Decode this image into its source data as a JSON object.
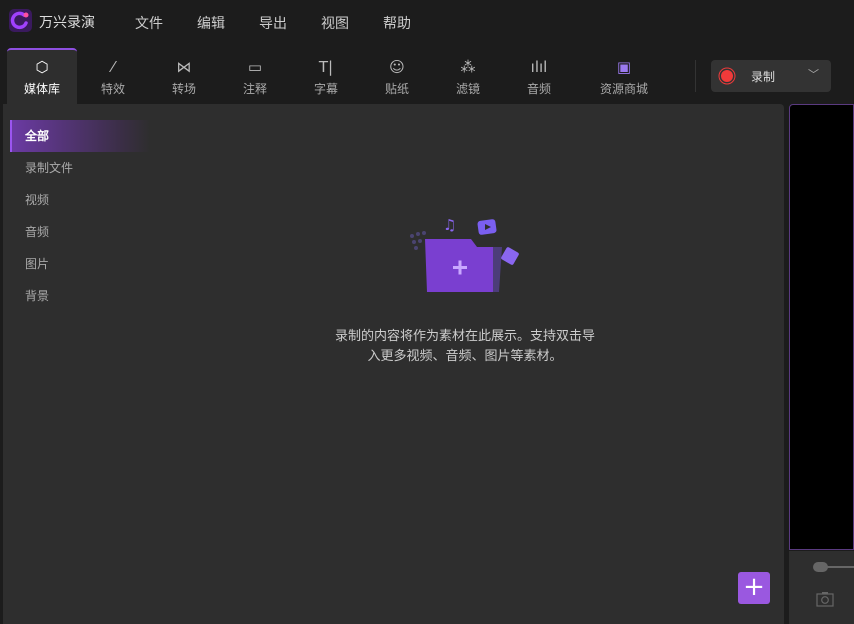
{
  "app": {
    "title": "万兴录演"
  },
  "menu": [
    "文件",
    "编辑",
    "导出",
    "视图",
    "帮助"
  ],
  "tabs": [
    {
      "label": "媒体库",
      "icon": "cube-icon"
    },
    {
      "label": "特效",
      "icon": "magic-wand-icon"
    },
    {
      "label": "转场",
      "icon": "transition-icon"
    },
    {
      "label": "注释",
      "icon": "comment-icon"
    },
    {
      "label": "字幕",
      "icon": "text-icon"
    },
    {
      "label": "贴纸",
      "icon": "smiley-icon"
    },
    {
      "label": "滤镜",
      "icon": "filter-icon"
    },
    {
      "label": "音频",
      "icon": "audio-wave-icon"
    },
    {
      "label": "资源商城",
      "icon": "store-icon"
    }
  ],
  "record": {
    "label": "录制",
    "color": "#f03a3a"
  },
  "sidebar": [
    "全部",
    "录制文件",
    "视频",
    "音频",
    "图片",
    "背景"
  ],
  "empty": {
    "line1": "录制的内容将作为素材在此展示。支持双击导",
    "line2": "入更多视频、音频、图片等素材。"
  },
  "colors": {
    "accent": "#9a58e0"
  }
}
